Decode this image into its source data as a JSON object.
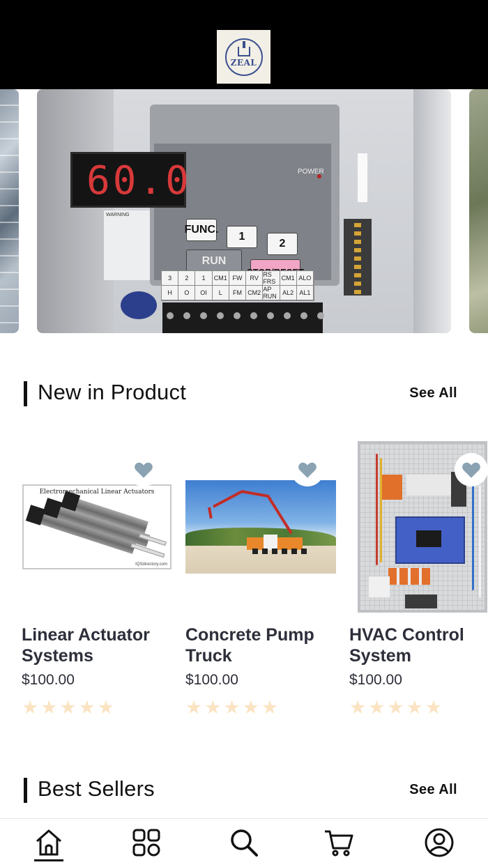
{
  "header": {
    "logo_text": "ZEAL",
    "background": "#000000"
  },
  "banner": {
    "slides": [
      "solar-panels",
      "frequency-inverter-keypad",
      "trees"
    ],
    "display_readout": "60.0",
    "labels": {
      "power": "POWER",
      "func": "FUNC.",
      "up": "1",
      "down": "2",
      "run": "RUN",
      "stop": "STOP/RESET",
      "warning": "WARNING"
    },
    "terminal_row1": [
      "3",
      "2",
      "1",
      "CM1",
      "FW",
      "RV",
      "RS FRS",
      "CM1",
      "ALO"
    ],
    "terminal_row2": [
      "H",
      "O",
      "OI",
      "L",
      "FM",
      "CM2",
      "AP RUN",
      "AL2",
      "AL1"
    ]
  },
  "new_products": {
    "title": "New in Product",
    "see_all": "See All",
    "items": [
      {
        "title": "Linear Actuator Systems",
        "price": "$100.00",
        "rating": 0,
        "image_caption": "Electromechanical Linear Actuators",
        "image_source": "IQSdirectory.com",
        "icon": "heart-icon"
      },
      {
        "title": "Concrete Pump Truck",
        "price": "$100.00",
        "rating": 0,
        "icon": "heart-icon"
      },
      {
        "title": "HVAC Control System",
        "price": "$100.00",
        "rating": 0,
        "icon": "heart-icon"
      }
    ]
  },
  "best_sellers": {
    "title": "Best Sellers",
    "see_all": "See All"
  },
  "bottom_nav": {
    "items": [
      "home-icon",
      "categories-icon",
      "search-icon",
      "cart-icon",
      "profile-icon"
    ],
    "active": "home-icon"
  },
  "colors": {
    "star_empty": "#fbe3c3",
    "heart": "#8aa2b2",
    "text_dark": "#2d2f3a"
  }
}
